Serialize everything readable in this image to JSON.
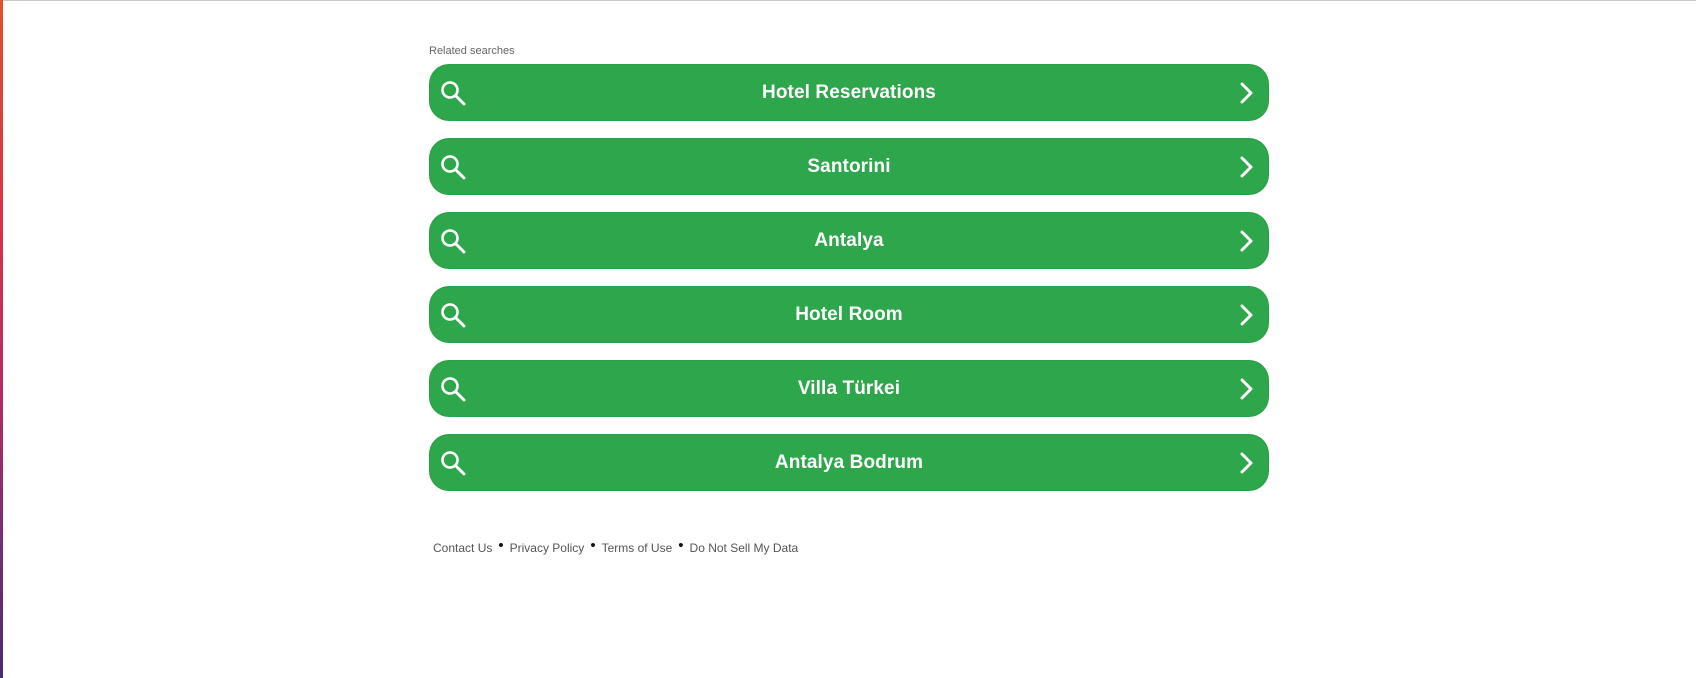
{
  "heading": "Related searches",
  "items": [
    {
      "label": "Hotel Reservations"
    },
    {
      "label": "Santorini"
    },
    {
      "label": "Antalya"
    },
    {
      "label": "Hotel Room"
    },
    {
      "label": "Villa Türkei"
    },
    {
      "label": "Antalya Bodrum"
    }
  ],
  "footer": {
    "links": [
      "Contact Us",
      "Privacy Policy",
      "Terms of Use",
      "Do Not Sell My Data"
    ],
    "separator": "•"
  },
  "colors": {
    "button_bg": "#2ea64c",
    "button_text": "#ffffff",
    "heading_text": "#666666"
  },
  "icons": {
    "left": "search-icon",
    "right": "chevron-right-icon"
  }
}
